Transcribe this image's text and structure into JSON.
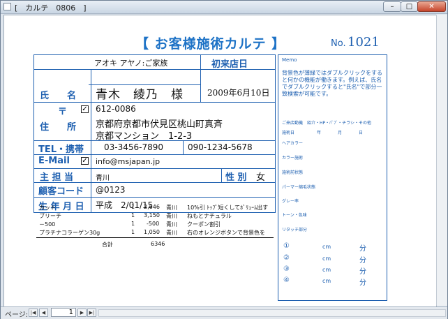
{
  "window": {
    "title": "[　カルテ　0806　]",
    "minimize": "–",
    "maximize": "□",
    "close": "✕"
  },
  "header": {
    "title": "【 お客様施術カルテ 】",
    "no_label": "No.",
    "no_value": "1021"
  },
  "form": {
    "kana": "アオキ アヤノ:ご家族",
    "first_visit_label": "初来店日",
    "first_visit_date": "2009年6月10日",
    "name_label": "氏　　名",
    "name_value": "青木　綾乃　様",
    "postal_mark": "〒",
    "postal_checked": "✓",
    "postal_code": "612-0086",
    "address_label": "住　　所",
    "address_line1": "京都府京都市伏見区桃山町真斉",
    "address_line2": "京都マンション　1-2-3",
    "tel_label": "TEL・携帯",
    "tel_value": "03-3456-7890",
    "mobile_value": "090-1234-5678",
    "email_label": "E-Mail",
    "email_checked": "✓",
    "email_value": "info@msjapan.jp",
    "staff_label": "主 担 当",
    "staff_value": "青川",
    "gender_label": "性 別",
    "gender_value": "女",
    "code_label": "顧客コード",
    "code_value": "@0123",
    "birth_label": "生 年 月 日",
    "birth_value": "平成　2/01/15"
  },
  "services": [
    {
      "name": "カット",
      "qty": "1",
      "price": "2,646",
      "staff": "青川",
      "note": "10%引 ﾄｯﾌﾟ短くしてﾎﾞﾘｭｰﾑ出す"
    },
    {
      "name": "ブリーチ",
      "qty": "1",
      "price": "3,150",
      "staff": "青川",
      "note": "ねもとナチュラル"
    },
    {
      "name": "－500",
      "qty": "1",
      "price": "-500",
      "staff": "青川",
      "note": "クーポン割引"
    },
    {
      "name": "プラチナコラーゲン30g",
      "qty": "1",
      "price": "1,050",
      "staff": "青川",
      "note": "右のオレンジボタンで背景色を"
    }
  ],
  "total": {
    "label": "合計",
    "value": "6346"
  },
  "memo": {
    "title": "Memo",
    "note": "背景色が薄緑ではダブルクリックをすると何かの機能が働きます。例えば、氏名でダブルクリックすると\"氏名\"で部分一致検索が可能です。",
    "motive": "ご来店動機　紹介・HP・ﾊﾟﾌﾞ・チラシ・その他",
    "date_label": "施術日",
    "year": "年",
    "month": "月",
    "day": "日",
    "items": [
      "ヘアカラー",
      "カラー施術",
      "施術前状態",
      "パーマー縮毛状態",
      "グレー率",
      "トーン・色味",
      "リタッチ部分"
    ],
    "timers": [
      {
        "num": "①",
        "unit1": "cm",
        "unit2": "分"
      },
      {
        "num": "②",
        "unit1": "cm",
        "unit2": "分"
      },
      {
        "num": "③",
        "unit1": "cm",
        "unit2": "分"
      },
      {
        "num": "④",
        "unit1": "cm",
        "unit2": "分"
      }
    ]
  },
  "statusbar": {
    "page_label": "ページ:",
    "first": "|◀",
    "prev": "◀",
    "page_number": "1",
    "next": "▶",
    "last": "▶|"
  }
}
